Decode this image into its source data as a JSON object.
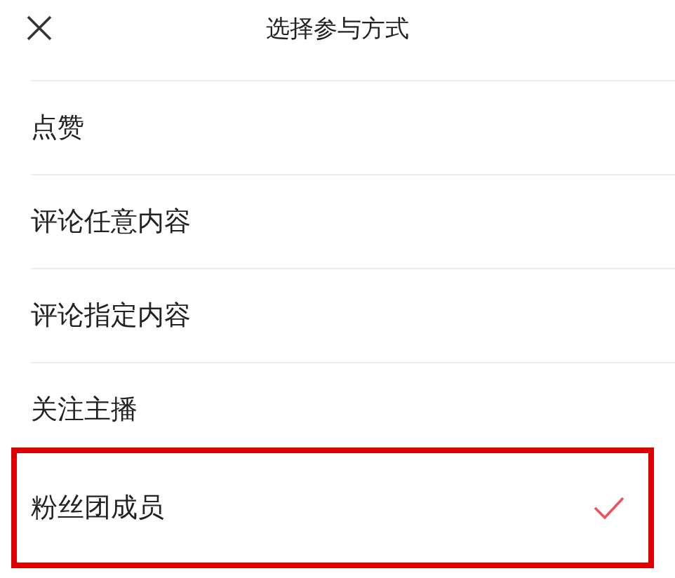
{
  "header": {
    "title": "选择参与方式"
  },
  "options": [
    {
      "label": "点赞",
      "selected": false,
      "highlighted": false
    },
    {
      "label": "评论任意内容",
      "selected": false,
      "highlighted": false
    },
    {
      "label": "评论指定内容",
      "selected": false,
      "highlighted": false
    },
    {
      "label": "关注主播",
      "selected": false,
      "highlighted": false
    },
    {
      "label": "粉丝团成员",
      "selected": true,
      "highlighted": true
    }
  ]
}
